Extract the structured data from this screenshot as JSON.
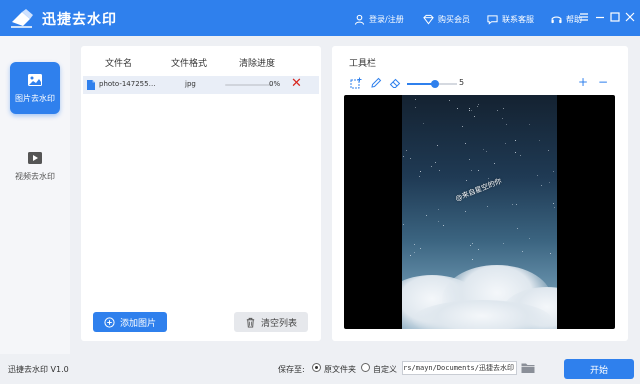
{
  "app": {
    "name": "迅捷去水印",
    "version_label": "迅捷去水印 V1.0"
  },
  "titlebar": {
    "login": "登录/注册",
    "buy_vip": "购买会员",
    "contact": "联系客服",
    "help": "帮助"
  },
  "sidebar": {
    "items": [
      {
        "label": "图片去水印",
        "icon": "image-icon",
        "active": true
      },
      {
        "label": "视频去水印",
        "icon": "video-icon",
        "active": false
      }
    ]
  },
  "file_list": {
    "columns": [
      "文件名",
      "文件格式",
      "清除进度"
    ],
    "rows": [
      {
        "name": "photo-147255…",
        "format": "jpg",
        "progress_text": "0%",
        "progress": 0
      }
    ],
    "add_button": "添加图片",
    "clear_button": "清空列表"
  },
  "toolbar": {
    "title": "工具栏",
    "brush_size": "5",
    "brush_fraction": 0.55,
    "zoom_in": "+",
    "zoom_out": "−"
  },
  "preview": {
    "watermark_text": "@来自星空的你"
  },
  "footer": {
    "save_to_label": "保存至:",
    "option_original": "原文件夹",
    "option_custom": "自定义",
    "path_value": "C:/Users/mayn/Documents/迅捷去水印",
    "start_button": "开始"
  },
  "colors": {
    "accent": "#2f80ed",
    "delete": "#d7261e"
  }
}
